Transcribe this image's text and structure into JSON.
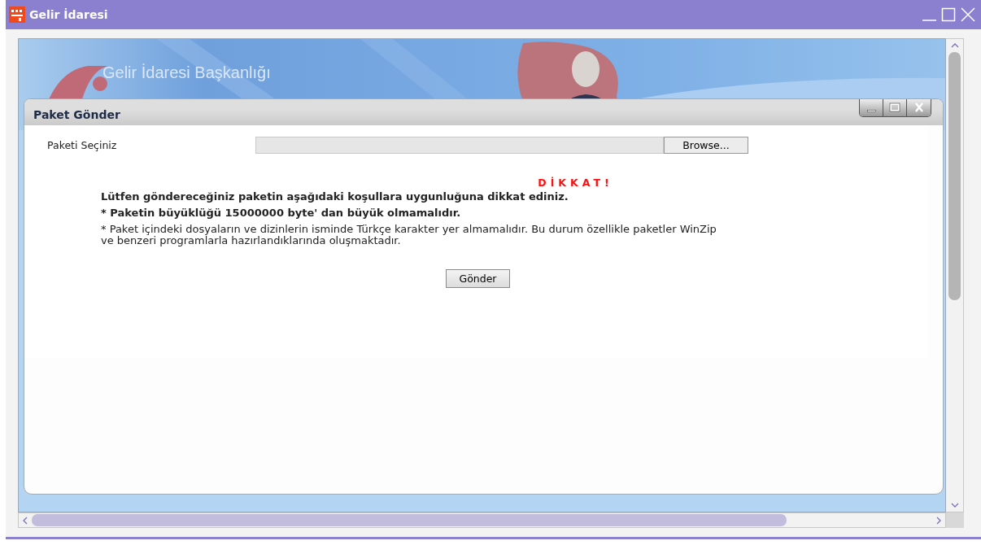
{
  "window": {
    "title": "Gelir İdaresi"
  },
  "banner": {
    "heading": "Gelir İdaresi Başkanlığı"
  },
  "dialog": {
    "title": "Paket Gönder",
    "file_row": {
      "label": "Paketi Seçiniz",
      "button": "Browse..."
    },
    "warning": {
      "title": "DİKKAT!",
      "lines": [
        {
          "text": "Lütfen göndereceğiniz paketin aşağıdaki koşullara uygunluğuna dikkat ediniz.",
          "bold": true
        },
        {
          "text": "* Paketin büyüklüğü 15000000 byte' dan büyük olmamalıdır.",
          "bold": true
        },
        {
          "text": "* Paket içindeki dosyaların ve dizinlerin isminde Türkçe karakter yer almamalıdır. Bu durum özellikle paketler WinZip ve benzeri programlarla hazırlandıklarında oluşmaktadır.",
          "bold": false
        }
      ]
    },
    "submit": "Gönder"
  }
}
